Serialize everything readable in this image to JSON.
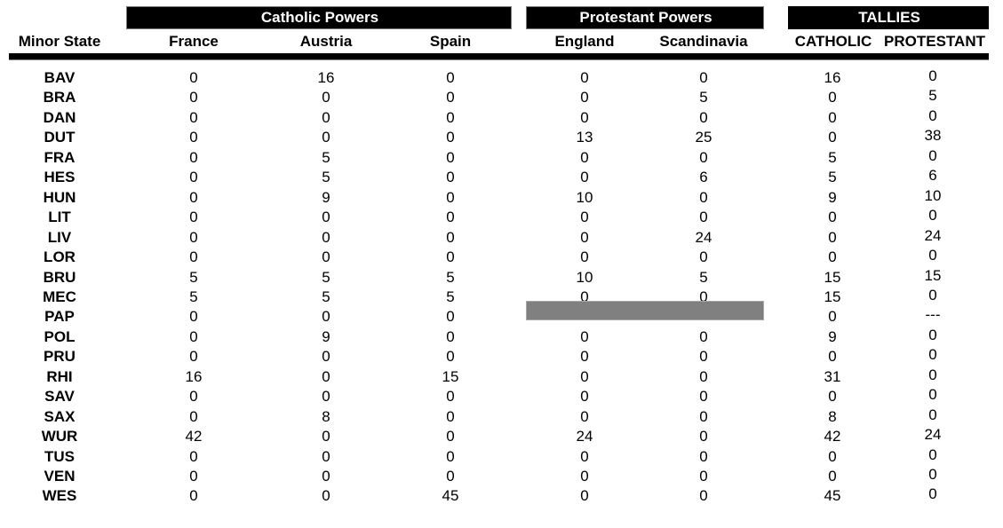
{
  "groups": {
    "catholic": "Catholic Powers",
    "protestant": "Protestant Powers",
    "tallies": "TALLIES"
  },
  "columns": {
    "state": "Minor State",
    "france": "France",
    "austria": "Austria",
    "spain": "Spain",
    "england": "England",
    "scandinavia": "Scandinavia",
    "catholic_total": "CATHOLIC",
    "protestant_total": "PROTESTANT"
  },
  "colors": {
    "header_bg": "#000000",
    "na_fill": "#808080"
  },
  "rows": [
    {
      "state": "BAV",
      "france": "0",
      "austria": "16",
      "spain": "0",
      "england": "0",
      "scandinavia": "0",
      "catholic": "16",
      "protestant": "0"
    },
    {
      "state": "BRA",
      "france": "0",
      "austria": "0",
      "spain": "0",
      "england": "0",
      "scandinavia": "5",
      "catholic": "0",
      "protestant": "5"
    },
    {
      "state": "DAN",
      "france": "0",
      "austria": "0",
      "spain": "0",
      "england": "0",
      "scandinavia": "0",
      "catholic": "0",
      "protestant": "0"
    },
    {
      "state": "DUT",
      "france": "0",
      "austria": "0",
      "spain": "0",
      "england": "13",
      "scandinavia": "25",
      "catholic": "0",
      "protestant": "38"
    },
    {
      "state": "FRA",
      "france": "0",
      "austria": "5",
      "spain": "0",
      "england": "0",
      "scandinavia": "0",
      "catholic": "5",
      "protestant": "0"
    },
    {
      "state": "HES",
      "france": "0",
      "austria": "5",
      "spain": "0",
      "england": "0",
      "scandinavia": "6",
      "catholic": "5",
      "protestant": "6"
    },
    {
      "state": "HUN",
      "france": "0",
      "austria": "9",
      "spain": "0",
      "england": "10",
      "scandinavia": "0",
      "catholic": "9",
      "protestant": "10"
    },
    {
      "state": "LIT",
      "france": "0",
      "austria": "0",
      "spain": "0",
      "england": "0",
      "scandinavia": "0",
      "catholic": "0",
      "protestant": "0"
    },
    {
      "state": "LIV",
      "france": "0",
      "austria": "0",
      "spain": "0",
      "england": "0",
      "scandinavia": "24",
      "catholic": "0",
      "protestant": "24"
    },
    {
      "state": "LOR",
      "france": "0",
      "austria": "0",
      "spain": "0",
      "england": "0",
      "scandinavia": "0",
      "catholic": "0",
      "protestant": "0"
    },
    {
      "state": "BRU",
      "france": "5",
      "austria": "5",
      "spain": "5",
      "england": "10",
      "scandinavia": "5",
      "catholic": "15",
      "protestant": "15"
    },
    {
      "state": "MEC",
      "france": "5",
      "austria": "5",
      "spain": "5",
      "england": "0",
      "scandinavia": "0",
      "catholic": "15",
      "protestant": "0"
    },
    {
      "state": "PAP",
      "france": "0",
      "austria": "0",
      "spain": "0",
      "england": null,
      "scandinavia": null,
      "catholic": "0",
      "protestant": "---",
      "protestant_na": true
    },
    {
      "state": "POL",
      "france": "0",
      "austria": "9",
      "spain": "0",
      "england": "0",
      "scandinavia": "0",
      "catholic": "9",
      "protestant": "0"
    },
    {
      "state": "PRU",
      "france": "0",
      "austria": "0",
      "spain": "0",
      "england": "0",
      "scandinavia": "0",
      "catholic": "0",
      "protestant": "0"
    },
    {
      "state": "RHI",
      "france": "16",
      "austria": "0",
      "spain": "15",
      "england": "0",
      "scandinavia": "0",
      "catholic": "31",
      "protestant": "0"
    },
    {
      "state": "SAV",
      "france": "0",
      "austria": "0",
      "spain": "0",
      "england": "0",
      "scandinavia": "0",
      "catholic": "0",
      "protestant": "0"
    },
    {
      "state": "SAX",
      "france": "0",
      "austria": "8",
      "spain": "0",
      "england": "0",
      "scandinavia": "0",
      "catholic": "8",
      "protestant": "0"
    },
    {
      "state": "WUR",
      "france": "42",
      "austria": "0",
      "spain": "0",
      "england": "24",
      "scandinavia": "0",
      "catholic": "42",
      "protestant": "24"
    },
    {
      "state": "TUS",
      "france": "0",
      "austria": "0",
      "spain": "0",
      "england": "0",
      "scandinavia": "0",
      "catholic": "0",
      "protestant": "0"
    },
    {
      "state": "VEN",
      "france": "0",
      "austria": "0",
      "spain": "0",
      "england": "0",
      "scandinavia": "0",
      "catholic": "0",
      "protestant": "0"
    },
    {
      "state": "WES",
      "france": "0",
      "austria": "0",
      "spain": "45",
      "england": "0",
      "scandinavia": "0",
      "catholic": "45",
      "protestant": "0"
    }
  ]
}
